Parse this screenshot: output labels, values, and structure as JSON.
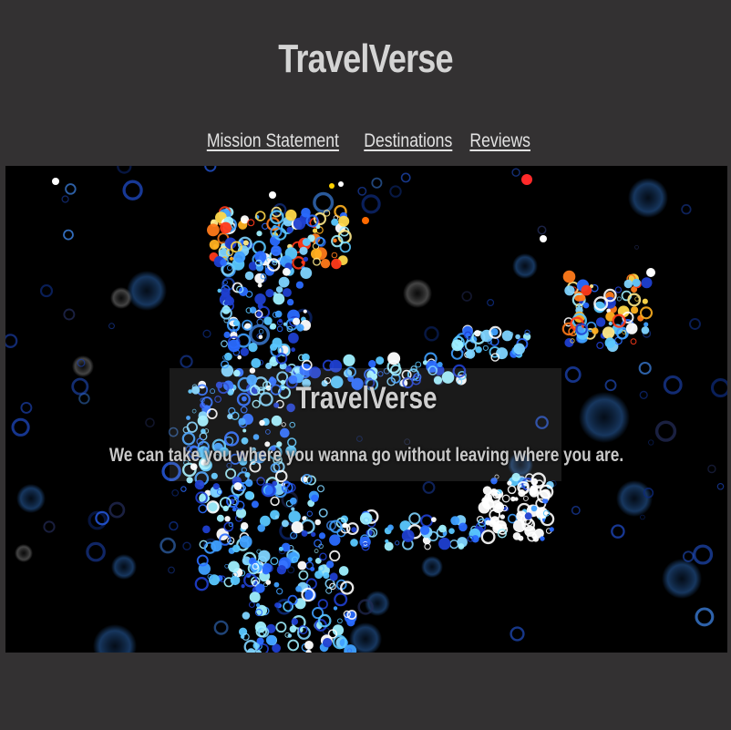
{
  "site": {
    "title": "TravelVerse"
  },
  "nav": {
    "items": [
      {
        "label": "Mission Statement"
      },
      {
        "label": "Destinations"
      },
      {
        "label": "Reviews"
      }
    ]
  },
  "hero": {
    "title": "TravelVerse",
    "tagline": "We can take you where you wanna go without leaving where you are.",
    "image_description_icon": "particle-figure-icon"
  },
  "colors": {
    "page_background": "#333132",
    "hero_background": "#000000",
    "text": "#d4d4d4"
  }
}
